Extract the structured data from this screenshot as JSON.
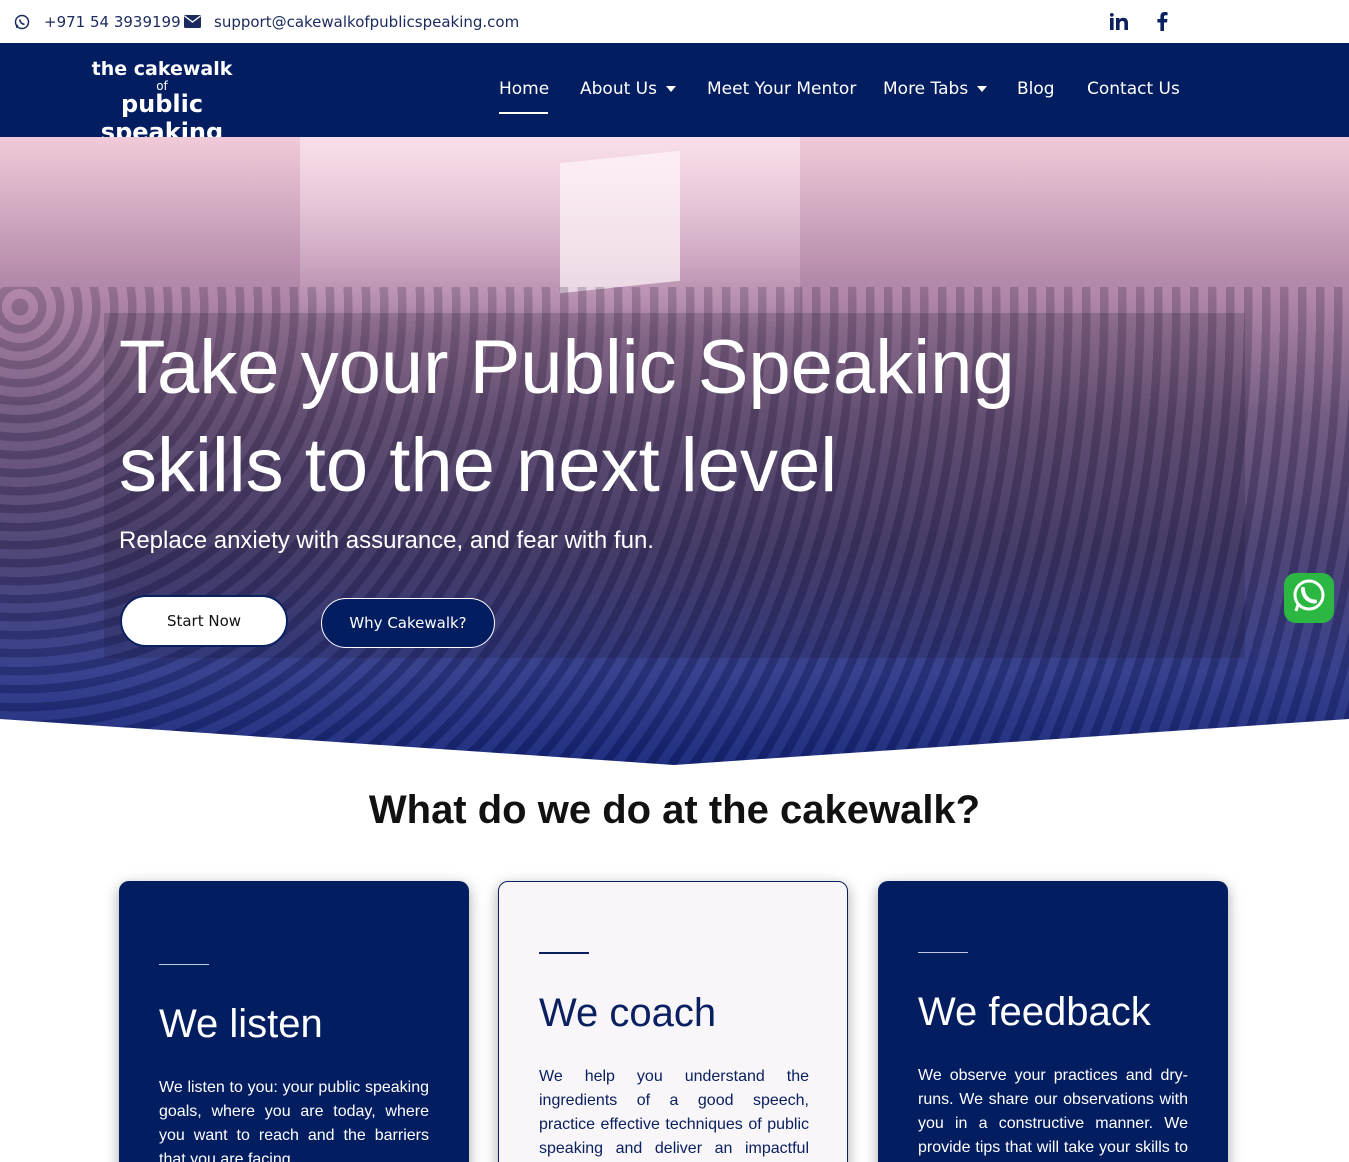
{
  "topbar": {
    "phone": "+971 54 3939199",
    "email": "support@cakewalkofpublicspeaking.com",
    "phone_icon": "whatsapp-icon",
    "email_icon": "envelope-icon",
    "social": [
      "linkedin-icon",
      "facebook-icon"
    ]
  },
  "logo": {
    "line1": "the cakewalk",
    "line2": "of",
    "line3": "public speaking"
  },
  "nav": {
    "home": "Home",
    "about": "About Us",
    "mentor": "Meet Your Mentor",
    "more": "More Tabs",
    "blog": "Blog",
    "contact": "Contact Us"
  },
  "hero": {
    "title_line1": "Take your Public Speaking",
    "title_line2": "skills to the next level",
    "subtitle": "Replace anxiety with assurance, and fear with fun.",
    "btn_start": "Start Now",
    "btn_why": "Why Cakewalk?"
  },
  "section": {
    "title": "What do we do at the cakewalk?"
  },
  "cards": [
    {
      "title": "We listen",
      "text": "We listen to you: your public speaking goals, where you are today, where you want to reach and the barriers that you are facing."
    },
    {
      "title": "We coach",
      "text": "We help you understand the ingredients of a good speech, practice effective techniques of public speaking and deliver an impactful speech."
    },
    {
      "title": "We feedback",
      "text": "We observe your practices and dry-runs. We share our observations with you in a constructive manner. We provide tips that will take your skills to the next level."
    }
  ],
  "colors": {
    "brand_navy": "#031d61",
    "whatsapp_green": "#2bb741"
  }
}
